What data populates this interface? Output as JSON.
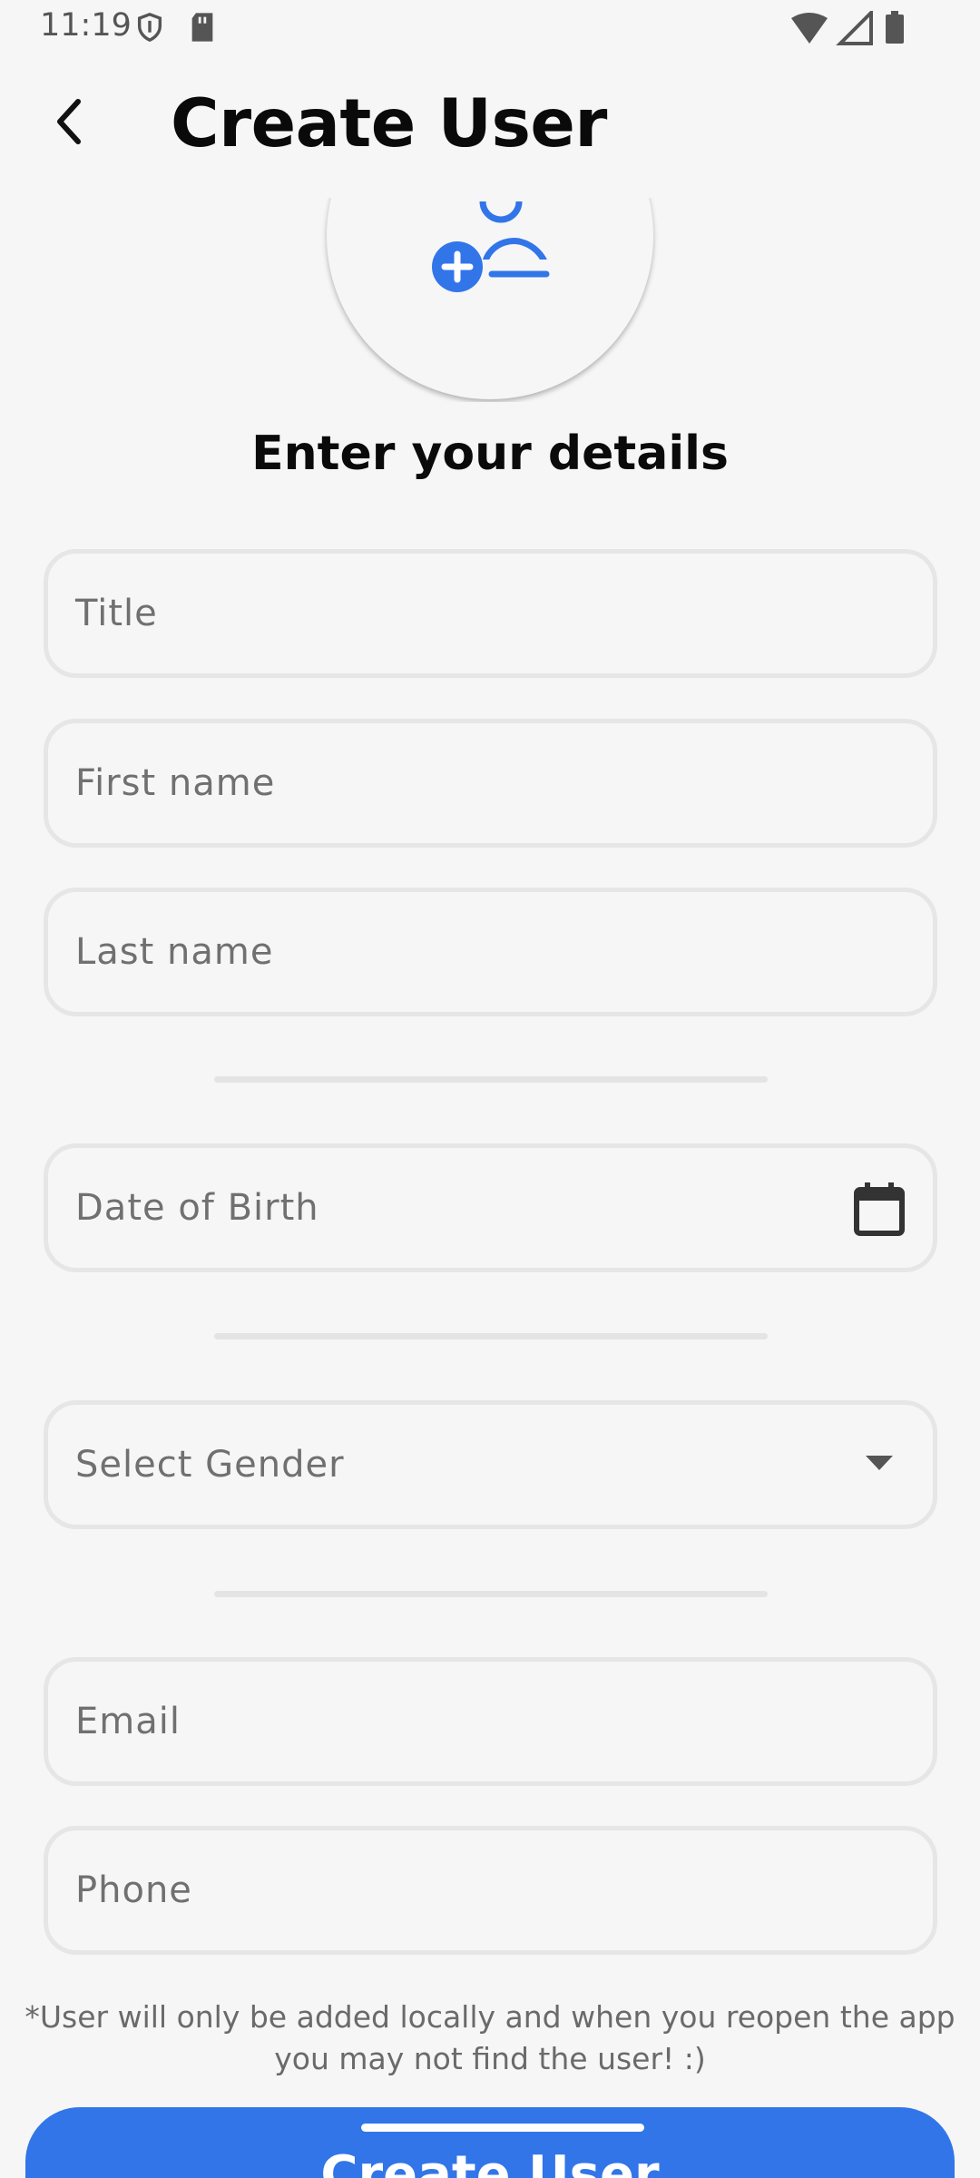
{
  "status_bar": {
    "time": "11:19",
    "icons_left": [
      "shield-icon",
      "sd-card-icon"
    ],
    "icons_right": [
      "wifi-icon",
      "cell-signal-icon",
      "battery-icon"
    ]
  },
  "app_bar": {
    "title": "Create User",
    "back_icon": "chevron-left-icon"
  },
  "avatar": {
    "icon": "add-user-icon",
    "accent": "#3275e9"
  },
  "heading": "Enter your details",
  "fields": {
    "title": {
      "placeholder": "Title"
    },
    "first_name": {
      "placeholder": "First name"
    },
    "last_name": {
      "placeholder": "Last name"
    },
    "dob": {
      "placeholder": "Date of Birth",
      "icon": "calendar-icon"
    },
    "gender": {
      "placeholder": "Select Gender",
      "icon": "dropdown-arrow-icon"
    },
    "email": {
      "placeholder": "Email"
    },
    "phone": {
      "placeholder": "Phone"
    }
  },
  "note": "*User will only be added locally and when you reopen the app you may not find the user! :)",
  "create_button": {
    "label": "Create User",
    "color": "#3275e9"
  }
}
